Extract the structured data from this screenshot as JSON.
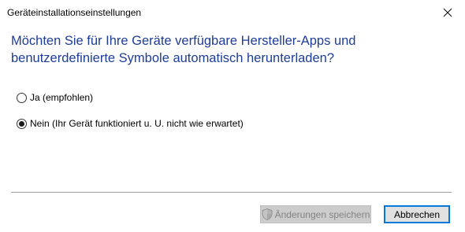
{
  "window": {
    "title": "Geräteinstallationseinstellungen",
    "close_icon": "close-icon"
  },
  "question": "Möchten Sie für Ihre Geräte verfügbare Hersteller-Apps und benutzerdefinierte Symbole automatisch herunterladen?",
  "options": [
    {
      "label": "Ja (empfohlen)",
      "selected": false
    },
    {
      "label": "Nein (Ihr Gerät funktioniert u. U. nicht wie erwartet)",
      "selected": true
    }
  ],
  "buttons": {
    "save": {
      "label": "Änderungen speichern",
      "enabled": false,
      "icon": "uac-shield-icon"
    },
    "cancel": {
      "label": "Abbrechen",
      "enabled": true,
      "default": true
    }
  },
  "colors": {
    "question_text": "#1e3d96",
    "focus_border": "#0078d7",
    "disabled_text": "#838383"
  }
}
